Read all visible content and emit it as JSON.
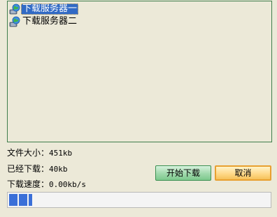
{
  "servers": {
    "items": [
      {
        "label": "下载服务器一",
        "icon": "server-globe-icon",
        "selected": true
      },
      {
        "label": "下载服务器二",
        "icon": "server-globe-icon",
        "selected": false
      }
    ]
  },
  "info": {
    "file_size_label": "文件大小：",
    "file_size_value": "451kb",
    "downloaded_label": "已经下载：",
    "downloaded_value": "40kb",
    "speed_label": "下载速度：",
    "speed_value": "0.00kb/s"
  },
  "buttons": {
    "start_label": "开始下载",
    "cancel_label": "取消"
  },
  "progress": {
    "fraction": 0.089
  },
  "colors": {
    "background": "#ece9d8",
    "selection": "#316ac5",
    "progress": "#3a6fd8",
    "start_button": "#9fd8ab",
    "cancel_button": "#ffd98a"
  }
}
